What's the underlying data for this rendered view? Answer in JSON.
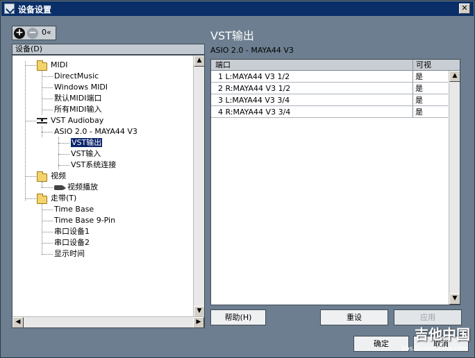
{
  "window": {
    "title": "设备设置"
  },
  "toolbar": {
    "add": "+",
    "remove": "−",
    "reset": "0«"
  },
  "tree": {
    "label": "设备(D)",
    "items": [
      {
        "label": "MIDI",
        "icon": "folder-icon"
      },
      {
        "label": "DirectMusic"
      },
      {
        "label": "Windows MIDI"
      },
      {
        "label": "默认MIDI端口"
      },
      {
        "label": "所有MIDI输入"
      },
      {
        "label": "VST Audiobay",
        "icon": "audio-icon"
      },
      {
        "label": "ASIO 2.0 - MAYA44 V3"
      },
      {
        "label": "VST输出",
        "selected": true
      },
      {
        "label": "VST输入"
      },
      {
        "label": "VST系统连接"
      },
      {
        "label": "视频",
        "icon": "folder-icon"
      },
      {
        "label": "视频播放",
        "icon": "video-icon"
      },
      {
        "label": "走带(T)",
        "icon": "folder-icon"
      },
      {
        "label": "Time Base"
      },
      {
        "label": "Time Base 9-Pin"
      },
      {
        "label": "串口设备1"
      },
      {
        "label": "串口设备2"
      },
      {
        "label": "显示时间"
      }
    ]
  },
  "panel": {
    "title": "VST输出",
    "device": "ASIO 2.0 - MAYA44 V3",
    "columns": {
      "port": "端口",
      "visible": "可视"
    },
    "rows": [
      {
        "port": "1 L:MAYA44 V3 1/2",
        "visible": "是"
      },
      {
        "port": "2 R:MAYA44 V3 1/2",
        "visible": "是"
      },
      {
        "port": "3 L:MAYA44 V3 3/4",
        "visible": "是"
      },
      {
        "port": "4 R:MAYA44 V3 3/4",
        "visible": "是"
      }
    ]
  },
  "buttons": {
    "help": "帮助(H)",
    "reset": "重设",
    "apply": "应用",
    "ok": "确定",
    "cancel": "取消"
  },
  "watermark": {
    "main": "吉他中国",
    "sub": "bbs.GuitarChina.com"
  }
}
